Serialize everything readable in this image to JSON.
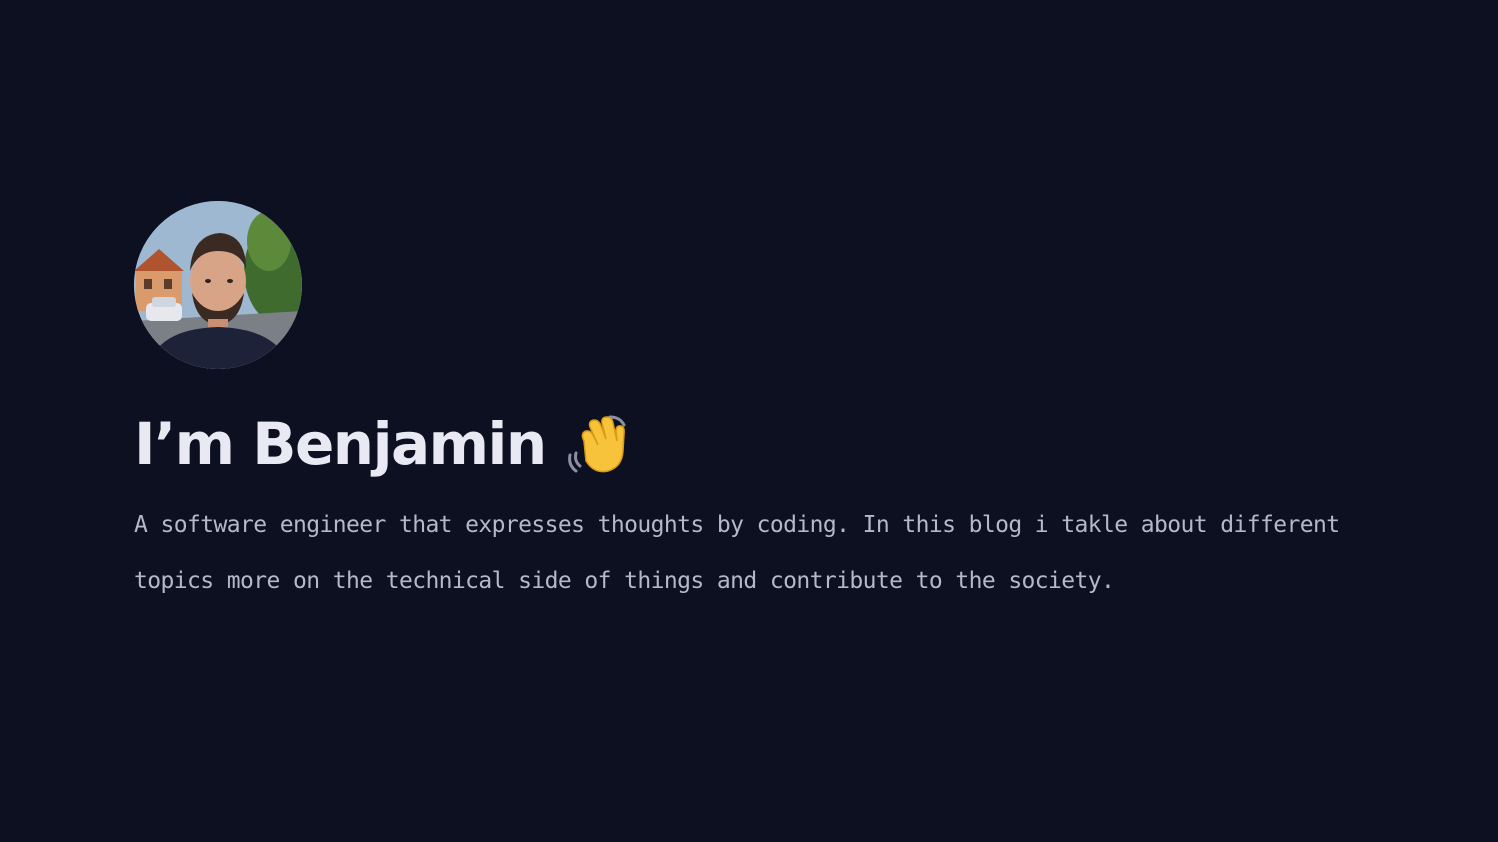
{
  "profile": {
    "heading": "I’m Benjamin",
    "wave_emoji_icon": "waving-hand-icon",
    "bio": "A software engineer that expresses thoughts by coding. In this blog i takle about different topics more on the technical side of things and contribute to the society."
  },
  "colors": {
    "background": "#0c1020",
    "heading": "#e8e9f3",
    "bio_text": "#b5b8c8"
  }
}
